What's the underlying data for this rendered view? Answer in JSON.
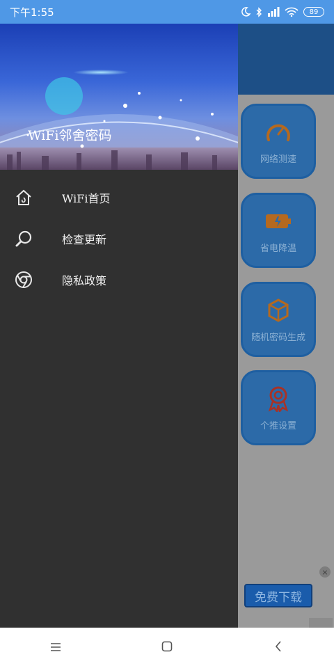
{
  "status_bar": {
    "time": "下午1:55",
    "battery": "89",
    "icons": [
      "moon-icon",
      "bluetooth-icon",
      "signal-icon",
      "wifi-icon",
      "battery-icon"
    ]
  },
  "drawer": {
    "title": "WiFi邻舍密码",
    "menu": [
      {
        "label": "WiFi首页",
        "icon": "home-icon"
      },
      {
        "label": "检查更新",
        "icon": "search-icon"
      },
      {
        "label": "隐私政策",
        "icon": "chrome-icon"
      }
    ]
  },
  "background_app": {
    "features": [
      {
        "label": "网络测速",
        "icon": "speedometer-icon",
        "color": "#c9762a"
      },
      {
        "label": "省电降温",
        "icon": "battery-charge-icon",
        "color": "#c9762a"
      },
      {
        "label": "随机密码生成",
        "icon": "cube-icon",
        "color": "#c9762a"
      },
      {
        "label": "个推设置",
        "icon": "award-icon",
        "color": "#c0392b"
      }
    ],
    "download_button": "免费下载",
    "ad_close": "×"
  },
  "nav_bar": {
    "icons": [
      "menu-icon",
      "home-square-icon",
      "back-icon"
    ]
  },
  "colors": {
    "status_bar": "#4f98e6",
    "drawer_bg": "#303030",
    "app_header": "#1d4f86"
  }
}
